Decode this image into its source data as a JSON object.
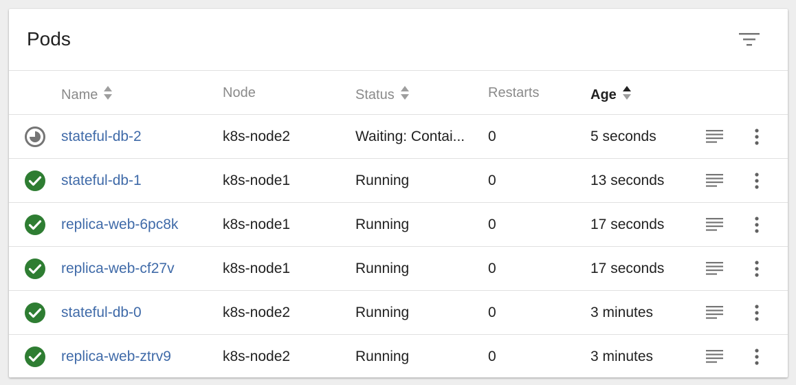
{
  "card": {
    "title": "Pods",
    "filter_icon": "filter-icon"
  },
  "columns": {
    "name": "Name",
    "node": "Node",
    "status": "Status",
    "restarts": "Restarts",
    "age": "Age"
  },
  "colors": {
    "link": "#3f6aa8",
    "success": "#2e7d32",
    "pending": "#757575"
  },
  "rows": [
    {
      "state": "pending",
      "icon": "pending-icon",
      "name": "stateful-db-2",
      "node": "k8s-node2",
      "status": "Waiting: Contai...",
      "restarts": "0",
      "age": "5 seconds"
    },
    {
      "state": "success",
      "icon": "check-circle-icon",
      "name": "stateful-db-1",
      "node": "k8s-node1",
      "status": "Running",
      "restarts": "0",
      "age": "13 seconds"
    },
    {
      "state": "success",
      "icon": "check-circle-icon",
      "name": "replica-web-6pc8k",
      "node": "k8s-node1",
      "status": "Running",
      "restarts": "0",
      "age": "17 seconds"
    },
    {
      "state": "success",
      "icon": "check-circle-icon",
      "name": "replica-web-cf27v",
      "node": "k8s-node1",
      "status": "Running",
      "restarts": "0",
      "age": "17 seconds"
    },
    {
      "state": "success",
      "icon": "check-circle-icon",
      "name": "stateful-db-0",
      "node": "k8s-node2",
      "status": "Running",
      "restarts": "0",
      "age": "3 minutes"
    },
    {
      "state": "success",
      "icon": "check-circle-icon",
      "name": "replica-web-ztrv9",
      "node": "k8s-node2",
      "status": "Running",
      "restarts": "0",
      "age": "3 minutes"
    }
  ]
}
